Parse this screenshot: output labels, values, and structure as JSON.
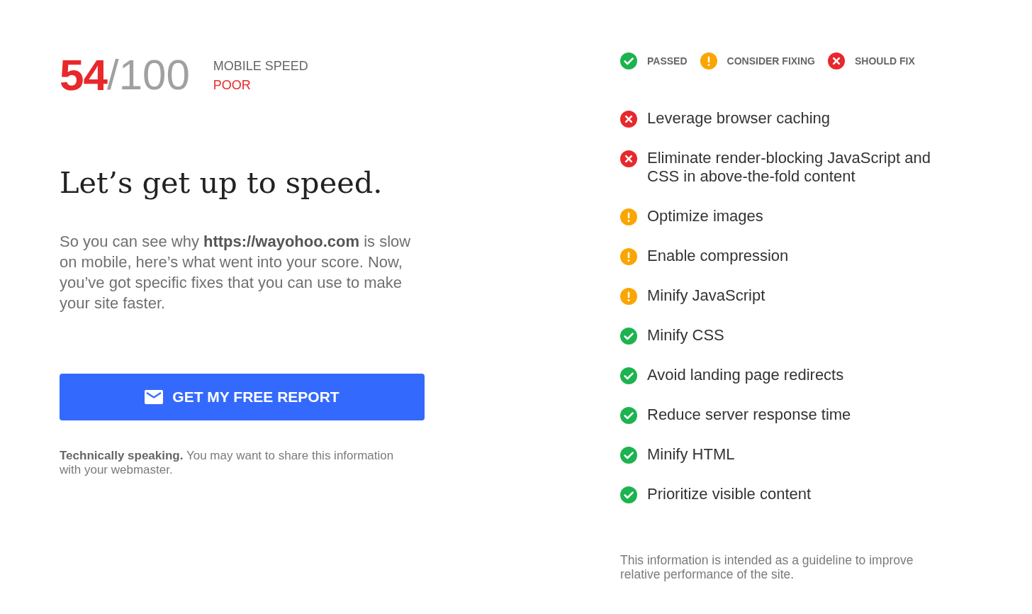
{
  "score": {
    "value": "54",
    "total": "/100",
    "label": "MOBILE SPEED",
    "rating": "POOR"
  },
  "heading": "Let’s get up to speed.",
  "intro": "So you can see why **https://wayohoo.com** is slow on mobile, here’s what went into your score. Now, you’ve got specific fixes that you can use to make your site faster.",
  "report_button": {
    "label": "GET MY FREE REPORT"
  },
  "note": "**Technically speaking.** You may want to share this information with your webmaster.",
  "legend": [
    {
      "kind": "passed",
      "label": "PASSED"
    },
    {
      "kind": "consider",
      "label": "CONSIDER FIXING"
    },
    {
      "kind": "fix",
      "label": "SHOULD FIX"
    }
  ],
  "rules": [
    {
      "kind": "fix",
      "label": "Leverage browser caching"
    },
    {
      "kind": "fix",
      "label": "Eliminate render-blocking JavaScript and CSS in above-the-fold content"
    },
    {
      "kind": "consider",
      "label": "Optimize images"
    },
    {
      "kind": "consider",
      "label": "Enable compression"
    },
    {
      "kind": "consider",
      "label": "Minify JavaScript"
    },
    {
      "kind": "passed",
      "label": "Minify CSS"
    },
    {
      "kind": "passed",
      "label": "Avoid landing page redirects"
    },
    {
      "kind": "passed",
      "label": "Reduce server response time"
    },
    {
      "kind": "passed",
      "label": "Minify HTML"
    },
    {
      "kind": "passed",
      "label": "Prioritize visible content"
    }
  ],
  "disclaimer": "This information is intended as a guideline to improve relative performance of the site."
}
